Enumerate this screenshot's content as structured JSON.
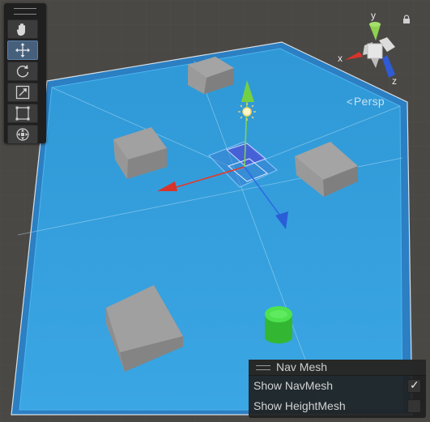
{
  "scene": {
    "view_mode_label": "Persp",
    "toolbar_tools": [
      {
        "name": "hand-tool",
        "icon": "hand-icon",
        "active": false
      },
      {
        "name": "move-tool",
        "icon": "move-arrows-icon",
        "active": true
      },
      {
        "name": "rotate-tool",
        "icon": "rotate-icon",
        "active": false
      },
      {
        "name": "scale-tool",
        "icon": "scale-icon",
        "active": false
      },
      {
        "name": "rect-tool",
        "icon": "rect-icon",
        "active": false
      },
      {
        "name": "transform-tool",
        "icon": "transform-icon",
        "active": false
      }
    ]
  },
  "gizmo": {
    "axes": {
      "y": "y",
      "x": "x",
      "z": "z"
    },
    "colors": {
      "y": "#8fd14f",
      "x": "#d9332a",
      "z": "#2f5bd4"
    }
  },
  "colors": {
    "navmesh": "#3aa2df",
    "navmesh_border": "#2e7bbf",
    "ground": "#4a4845",
    "obstacle": "#9b9b9b",
    "agent": "#3bd23b"
  },
  "nav_mesh_panel": {
    "title": "Nav Mesh",
    "show_navmesh_label": "Show NavMesh",
    "show_navmesh_checked": true,
    "show_navmesh_check": "✓",
    "show_heightmesh_label": "Show HeightMesh",
    "show_heightmesh_checked": false
  }
}
